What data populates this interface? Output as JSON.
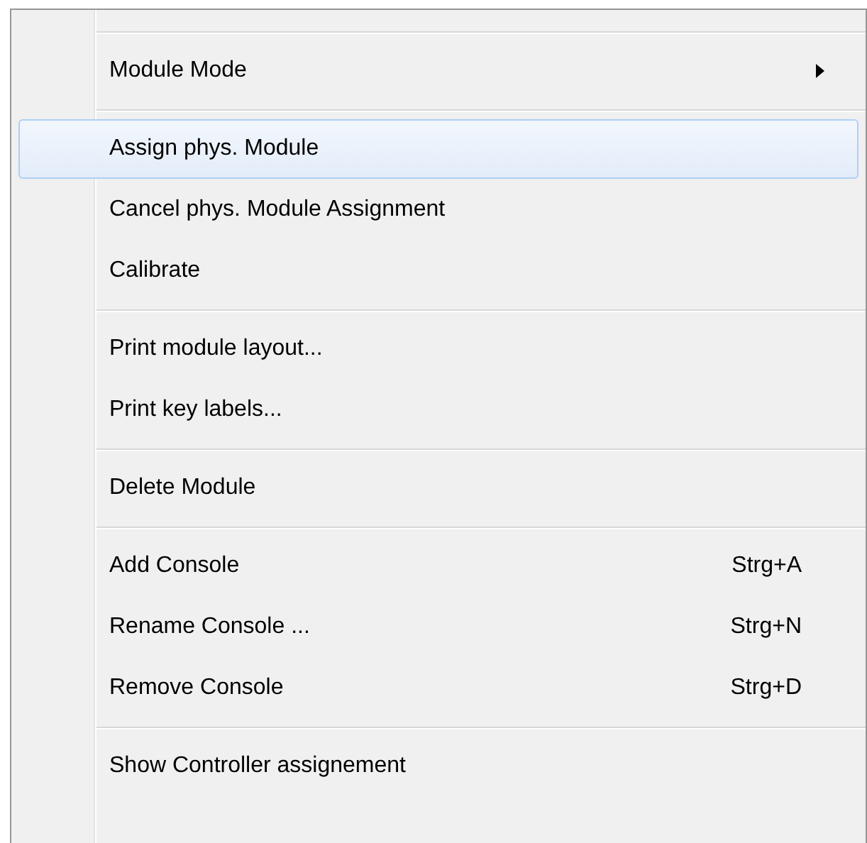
{
  "menu": {
    "entries": [
      {
        "kind": "separator"
      },
      {
        "kind": "item",
        "label": "Module Mode",
        "submenu": true,
        "selected": false
      },
      {
        "kind": "separator"
      },
      {
        "kind": "item",
        "label": "Assign phys. Module",
        "selected": true
      },
      {
        "kind": "item",
        "label": "Cancel phys. Module Assignment",
        "selected": false
      },
      {
        "kind": "item",
        "label": "Calibrate",
        "selected": false
      },
      {
        "kind": "separator"
      },
      {
        "kind": "item",
        "label": "Print module layout...",
        "selected": false
      },
      {
        "kind": "item",
        "label": "Print key labels...",
        "selected": false
      },
      {
        "kind": "separator"
      },
      {
        "kind": "item",
        "label": "Delete Module",
        "selected": false
      },
      {
        "kind": "separator"
      },
      {
        "kind": "item",
        "label": "Add Console",
        "shortcut": "Strg+A",
        "selected": false
      },
      {
        "kind": "item",
        "label": "Rename Console ...",
        "shortcut": "Strg+N",
        "selected": false
      },
      {
        "kind": "item",
        "label": "Remove Console",
        "shortcut": "Strg+D",
        "selected": false
      },
      {
        "kind": "separator"
      },
      {
        "kind": "item",
        "label": "Show Controller assignement",
        "selected": false
      }
    ]
  }
}
